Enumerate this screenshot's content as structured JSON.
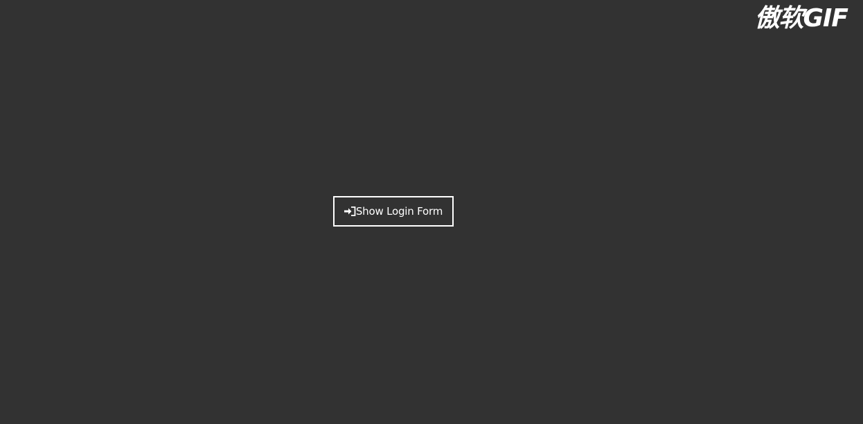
{
  "watermark": {
    "text": "傲软GIF"
  },
  "main": {
    "login_button": {
      "label": "Show Login Form",
      "icon": "sign-in-icon"
    }
  },
  "colors": {
    "background": "#323232",
    "foreground": "#ffffff"
  }
}
